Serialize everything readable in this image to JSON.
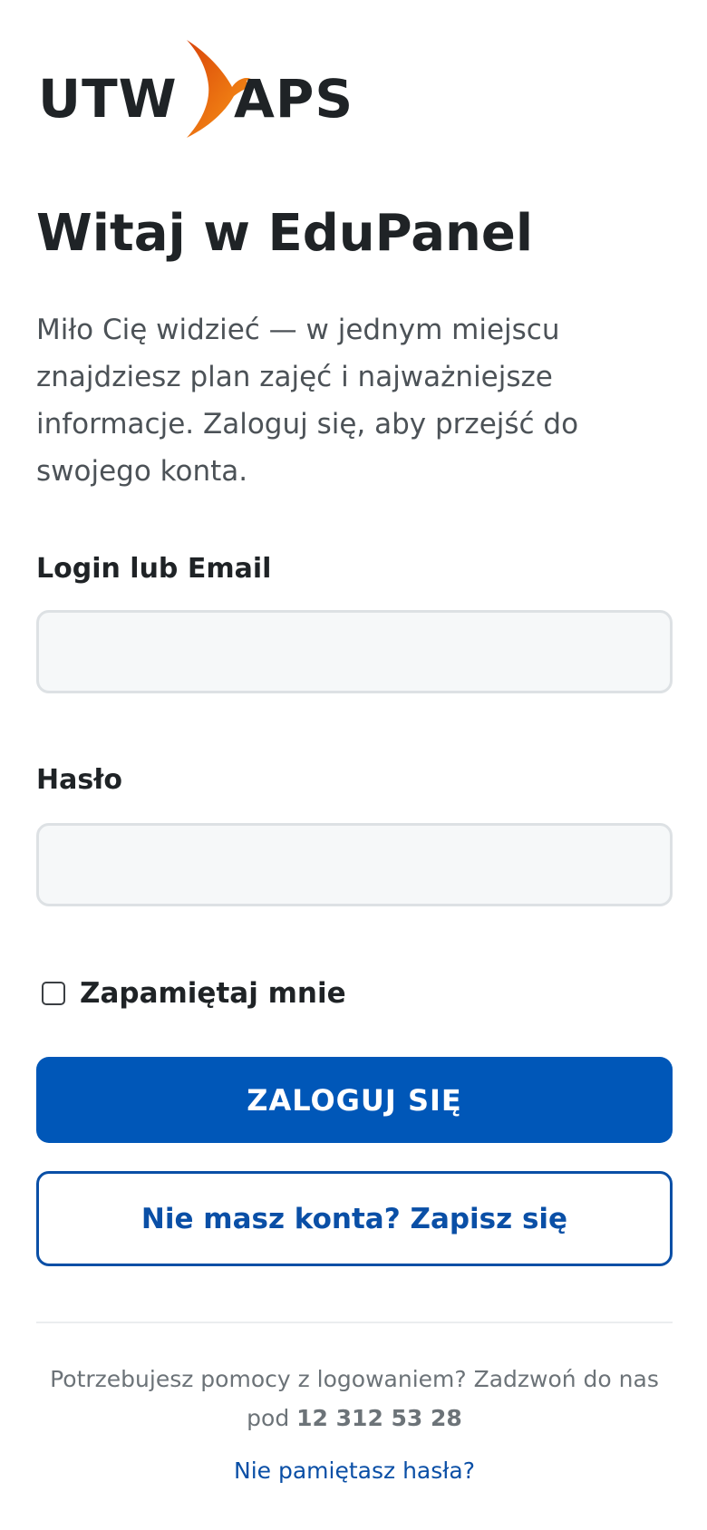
{
  "logo": {
    "left_text": "UTW",
    "right_text": "APS",
    "accent_color": "#e8650d"
  },
  "header": {
    "title": "Witaj w EduPanel",
    "intro": "Miło Cię widzieć — w jednym miejscu znajdziesz plan zajęć i najważniejsze informacje. Zaloguj się, aby przejść do swojego konta."
  },
  "form": {
    "login_label": "Login lub Email",
    "login_value": "",
    "login_placeholder": "",
    "password_label": "Hasło",
    "password_value": "",
    "password_placeholder": "",
    "remember_label": "Zapamiętaj mnie",
    "remember_checked": false,
    "submit_label": "ZALOGUJ SIĘ",
    "signup_label": "Nie masz konta? Zapisz się"
  },
  "footer": {
    "help_text": "Potrzebujesz pomocy z logowaniem? Zadzwoń do nas pod",
    "help_phone": "12 312 53 28",
    "forgot_label": "Nie pamiętasz hasła?"
  },
  "colors": {
    "primary": "#0057b8",
    "secondary_border": "#0a4fa6",
    "text": "#1f2326",
    "muted": "#6c7378"
  }
}
